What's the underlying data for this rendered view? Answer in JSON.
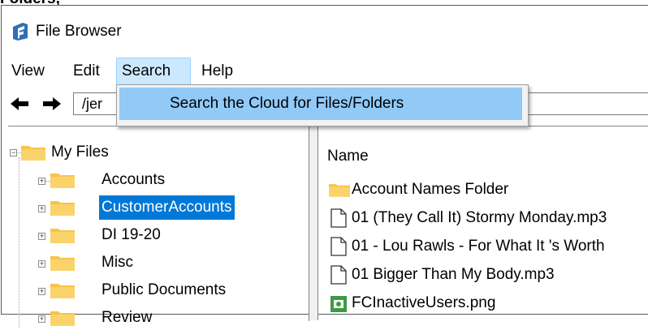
{
  "caption": "Folders,",
  "window": {
    "title": "File Browser"
  },
  "menu": {
    "items": [
      "View",
      "Edit",
      "Search",
      "Help"
    ],
    "active": "Search"
  },
  "search_menu": {
    "items": [
      "Search the Cloud for Files/Folders"
    ]
  },
  "toolbar": {
    "path": "/jer"
  },
  "tree": {
    "root": "My Files",
    "children": [
      "Accounts",
      "CustomerAccounts",
      "DI 19-20",
      "Misc",
      "Public Documents",
      "Review"
    ],
    "selected": "CustomerAccounts"
  },
  "list": {
    "header": "Name",
    "items": [
      {
        "name": "Account Names Folder",
        "icon": "folder-icon"
      },
      {
        "name": "01 (They Call It) Stormy Monday.mp3",
        "icon": "file-icon"
      },
      {
        "name": "01 - Lou Rawls - For What It 's Worth",
        "icon": "file-icon"
      },
      {
        "name": "01 Bigger Than My Body.mp3",
        "icon": "file-icon"
      },
      {
        "name": "FCInactiveUsers.png",
        "icon": "image-icon"
      }
    ]
  },
  "colors": {
    "selection": "#0078d7",
    "menu_highlight": "#91c9f7",
    "folder": "#f8c34a"
  }
}
